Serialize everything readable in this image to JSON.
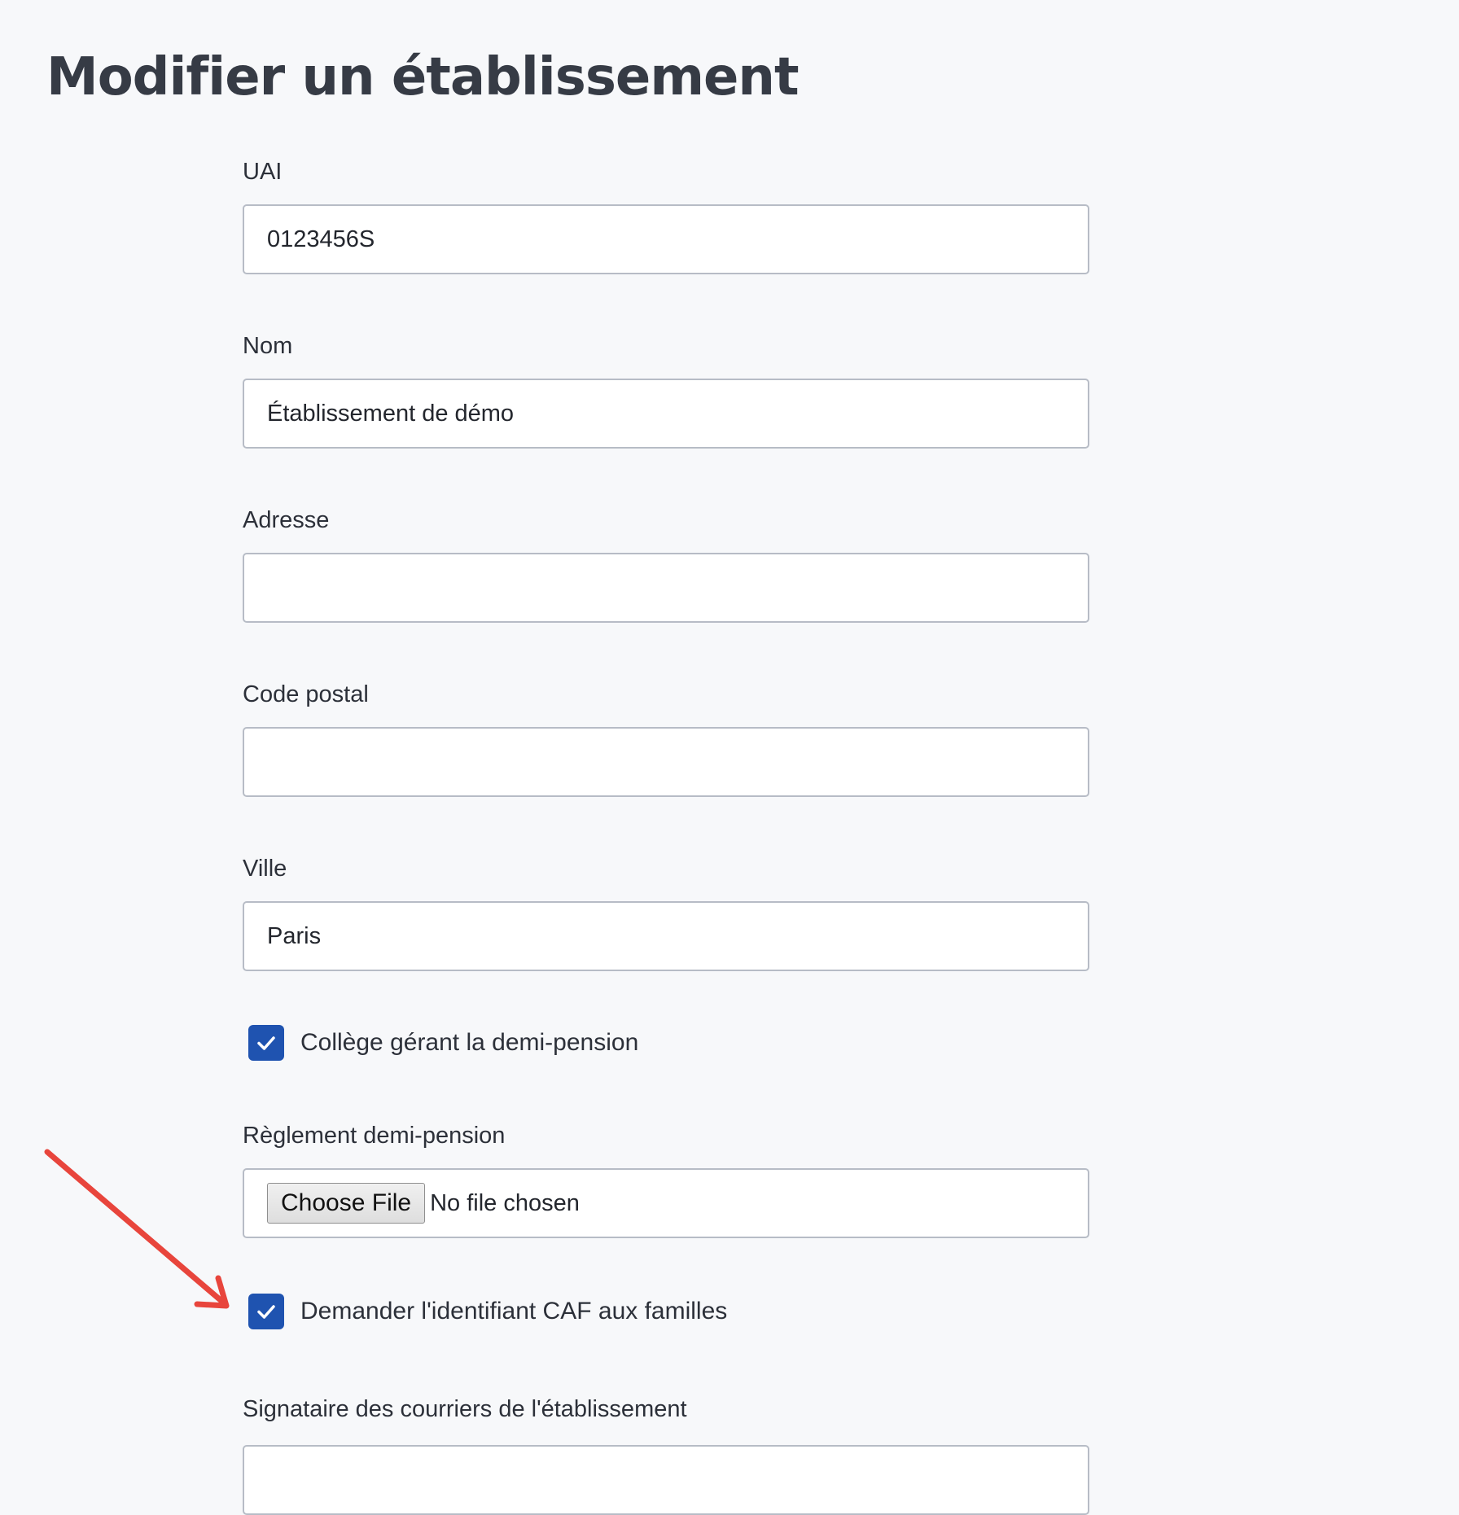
{
  "page": {
    "title": "Modifier un établissement"
  },
  "form": {
    "uai": {
      "label": "UAI",
      "value": "0123456S"
    },
    "nom": {
      "label": "Nom",
      "value": "Établissement de démo"
    },
    "adresse": {
      "label": "Adresse",
      "value": ""
    },
    "code_postal": {
      "label": "Code postal",
      "value": ""
    },
    "ville": {
      "label": "Ville",
      "value": "Paris"
    },
    "demi_pension_checkbox": {
      "label": "Collège gérant la demi-pension",
      "checked": true
    },
    "reglement": {
      "label": "Règlement demi-pension",
      "button_label": "Choose File",
      "status": "No file chosen"
    },
    "caf_checkbox": {
      "label": "Demander l'identifiant CAF aux familles",
      "checked": true
    },
    "signataire": {
      "label": "Signataire des courriers de l'établissement",
      "value": ""
    }
  },
  "colors": {
    "checkbox_fill": "#1f53b0",
    "annotation_arrow": "#e8453c",
    "background": "#f7f8fa"
  },
  "icons": {
    "checkmark": "check-icon",
    "annotation": "red-arrow-icon"
  }
}
